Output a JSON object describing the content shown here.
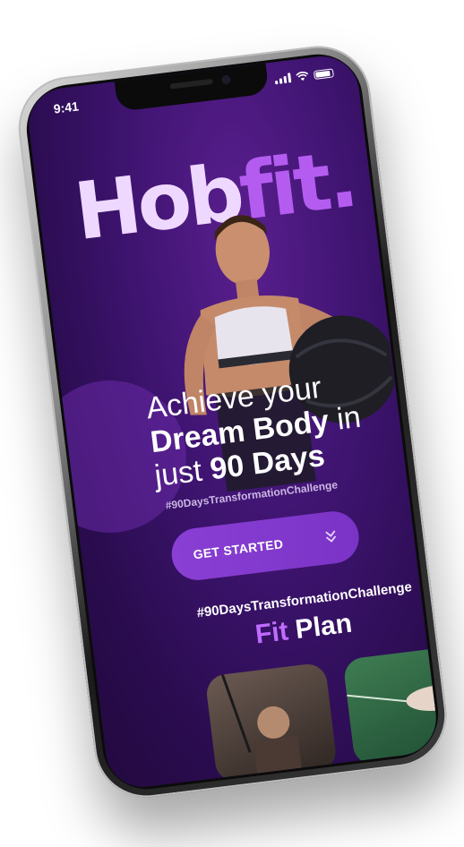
{
  "status": {
    "time": "9:41"
  },
  "logo": {
    "part1": "Hob",
    "part2": "fit."
  },
  "hero": {
    "line1": "Achieve your",
    "line2_bold": "Dream Body",
    "line2_rest": " in",
    "line3_thin": "just ",
    "line3_bold": "90 Days"
  },
  "hashtag_small": "#90DaysTransformationChallenge",
  "cta": {
    "label": "GET STARTED",
    "icon": "double-chevron-down-icon"
  },
  "section": {
    "hashtag": "#90DaysTransformationChallenge",
    "title_accent": "Fit",
    "title_rest": " Plan"
  },
  "colors": {
    "accent": "#b45cf0",
    "background": "#3e1470",
    "button": "#8a3fd4"
  }
}
